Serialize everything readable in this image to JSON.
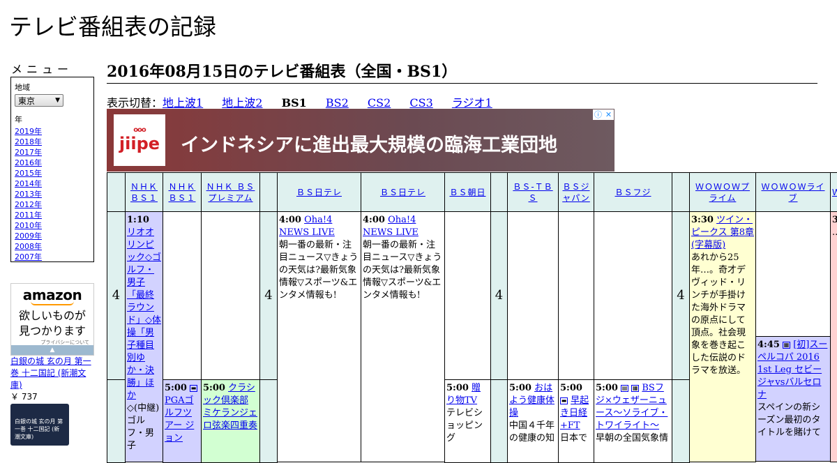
{
  "site": {
    "title": "テレビ番組表の記録"
  },
  "menu": {
    "heading": "メニュー",
    "region_label": "地域",
    "region_value": "東京",
    "year_label": "年",
    "years": [
      "2019年",
      "2018年",
      "2017年",
      "2016年",
      "2015年",
      "2014年",
      "2013年",
      "2012年",
      "2011年",
      "2010年",
      "2009年",
      "2008年",
      "2007年"
    ]
  },
  "amazon_ad": {
    "logo": "amazon",
    "tagline_1": "欲しいものが",
    "tagline_2": "見つかります",
    "privacy": "プライバシーについて",
    "bar": "▲"
  },
  "book": {
    "title": "白銀の城 玄の月 第一巻 十二国記 (新潮文庫)",
    "price": "￥ 737",
    "cover_text": "白銀の城 玄の月 第一巻 十二国記 (新潮文庫)"
  },
  "page": {
    "heading": "2016年08月15日のテレビ番組表（全国・BS1）",
    "switch_label": "表示切替："
  },
  "tabs": [
    {
      "label": "地上波1",
      "current": false
    },
    {
      "label": "地上波2",
      "current": false
    },
    {
      "label": "BS1",
      "current": true
    },
    {
      "label": "BS2",
      "current": false
    },
    {
      "label": "CS2",
      "current": false
    },
    {
      "label": "CS3",
      "current": false
    },
    {
      "label": "ラジオ1",
      "current": false
    }
  ],
  "banner": {
    "logo_text": "jiipe",
    "logo_dots": "ooo",
    "text": "インドネシアに進出最大規模の臨海工業団地",
    "adchoices_info": "ⓘ",
    "adchoices_close": "✕"
  },
  "schedule": {
    "headers": [
      "",
      "ＮＨＫ ＢＳ１",
      "ＮＨＫ ＢＳ１",
      "ＮＨＫ ＢＳプレミアム",
      "",
      "ＢＳ日テレ",
      "ＢＳ日テレ",
      "ＢＳ朝日",
      "",
      "ＢＳ-ＴＢＳ",
      "ＢＳジャパン",
      "ＢＳフジ",
      "",
      "ＷＯＷＯＷプライム",
      "ＷＯＷＯＷライブ",
      "Ｗ"
    ],
    "hour_label": "4",
    "programs": {
      "nhk1_a": {
        "time": "1:10",
        "title": "リオオリンピック◇ゴルフ・男子「最終ラウンド」◇体操「男子種目別ゆか・決勝」ほか",
        "desc": "◇(中継)ゴルフ・男子"
      },
      "nhk1_b": {
        "time": "5:00",
        "title": "PGAゴルフツアー ジョン"
      },
      "premium": {
        "time": "5:00",
        "title": "クラシック倶楽部 ミケランジェロ弦楽四重奏"
      },
      "ntv_a": {
        "time": "4:00",
        "title": "Oha!4 NEWS LIVE",
        "desc": "朝一番の最新・注目ニュース▽きょうの天気は?最新気象情報▽スポーツ&エンタメ情報も!"
      },
      "ntv_b": {
        "time": "4:00",
        "title": "Oha!4 NEWS LIVE",
        "desc": "朝一番の最新・注目ニュース▽きょうの天気は?最新気象情報▽スポーツ&エンタメ情報も!"
      },
      "asahi": {
        "time": "5:00",
        "title": "贈り物TV",
        "desc": "テレビショッピング"
      },
      "tbs": {
        "time": "5:00",
        "title": "おはよう健康体操",
        "desc": "中国４千年の健康の知"
      },
      "japan": {
        "time": "5:00",
        "title": "早起き日経+FT",
        "desc": "日本で"
      },
      "fuji": {
        "time": "5:00",
        "title": "BSフジ×ウェザーニュース～ソライブ・トワイライト～",
        "desc": "早朝の全国気象情"
      },
      "wowow_prime": {
        "time": "3:30",
        "title": "ツイン・ピークス 第8章(字幕版)",
        "desc": "あれから25年…。奇才デヴィッド・リンチが手掛けた海外ドラマの原点にして頂点。社会現象を巻き起こした伝説のドラマを放送。"
      },
      "wowow_live": {
        "time": "4:45",
        "title": "[初]スーペルコパ 2016 1st Leg セビージャvsバルセロナ",
        "desc": "スペインの新シーズン最初のタイトルを賭けて"
      },
      "wowow_cut": {
        "time": "3",
        "desc": "..."
      }
    }
  },
  "colors": {
    "header_bg": "#dff1ef",
    "nhk_bg": "#d2d2ff",
    "premium_bg": "#d2ffd2",
    "prime_bg": "#ffffd2",
    "live_bg": "#d2d2ff",
    "wowow3_bg": "#ffd2d2"
  }
}
